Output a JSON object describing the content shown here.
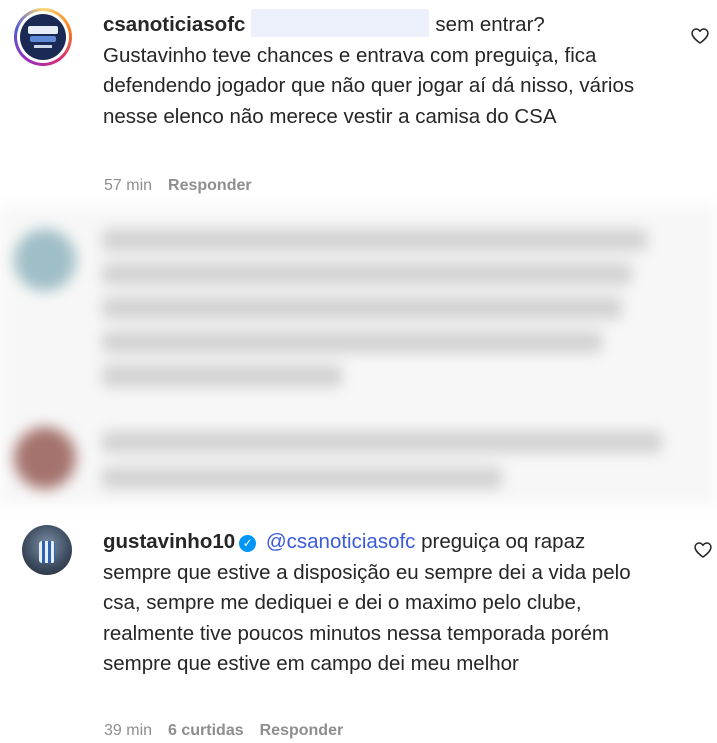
{
  "comments": [
    {
      "username": "csanoticiasofc",
      "text_after_redaction": "sem entrar?",
      "text_body": "Gustavinho teve chances e entrava com preguiça, fica defendendo jogador que não quer jogar aí dá nisso, vários nesse elenco não merece vestir a camisa do CSA",
      "time": "57 min",
      "reply_label": "Responder",
      "avatar_icon": "club-logo-icon"
    },
    {
      "username": "gustavinho10",
      "verified_icon": "verified-badge-icon",
      "mention": "@csanoticiasofc",
      "text": "preguiça oq rapaz sempre que estive a disposição eu sempre dei a vida pelo csa, sempre me dediquei e dei o maximo pelo clube, realmente tive poucos minutos nessa temporada porém sempre que estive em campo dei meu melhor",
      "time": "39 min",
      "likes": "6 curtidas",
      "reply_label": "Responder",
      "avatar_icon": "user-photo-icon"
    }
  ],
  "icons": {
    "like": "heart-outline-icon"
  },
  "colors": {
    "mention": "#3b5bdb",
    "meta": "#8e8e8e",
    "verified": "#0095f6"
  }
}
